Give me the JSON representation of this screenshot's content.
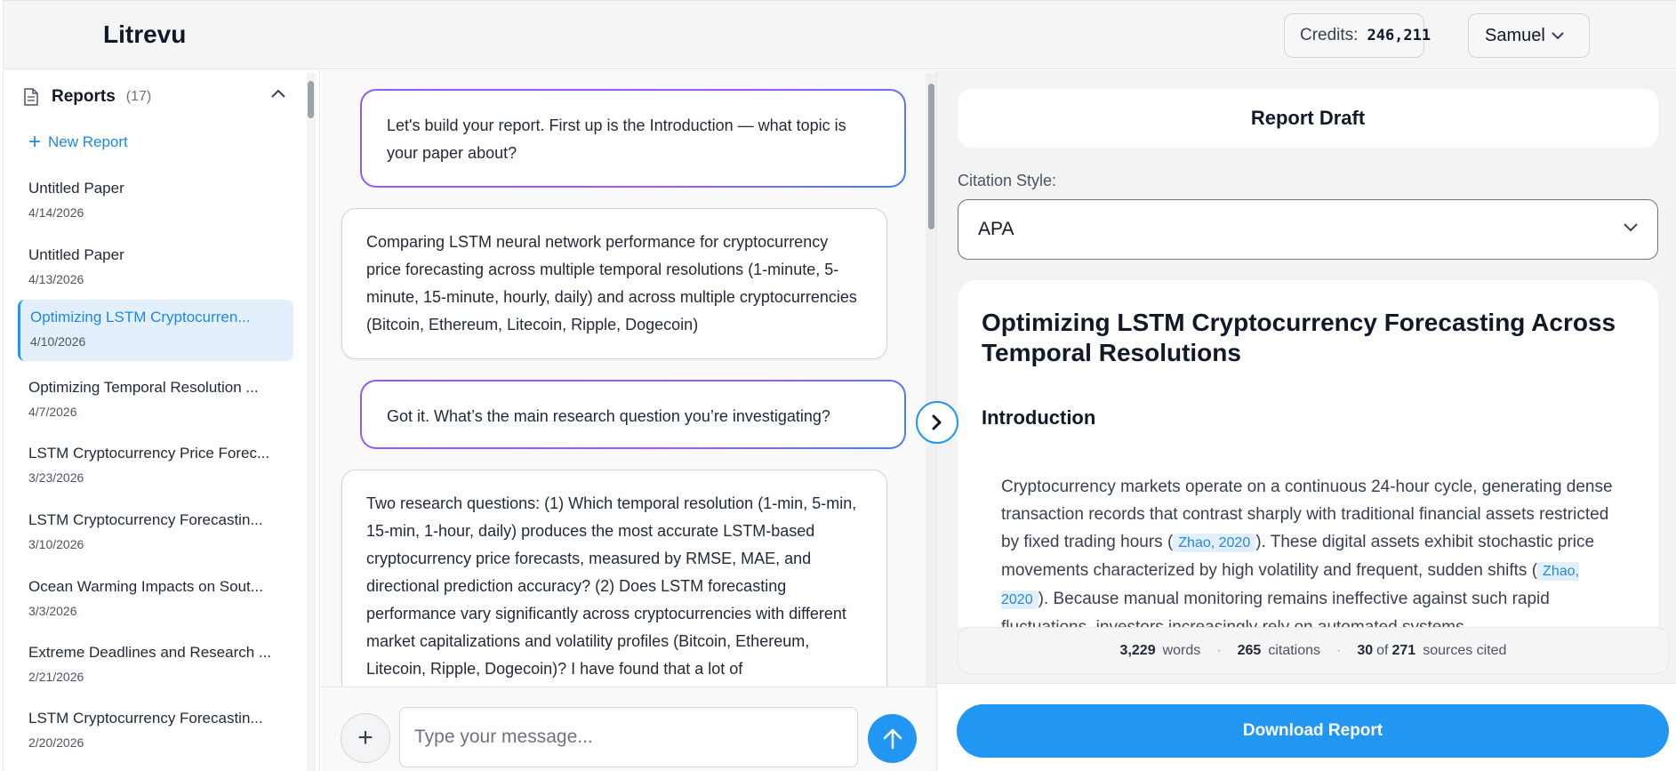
{
  "app": {
    "brand": "Litrevu"
  },
  "header": {
    "credits_label": "Credits:",
    "credits_value": "246,211",
    "user_name": "Samuel"
  },
  "sidebar": {
    "title": "Reports",
    "count": "(17)",
    "new_report_label": "New Report",
    "items": [
      {
        "title": "Untitled Paper",
        "date": "4/14/2026"
      },
      {
        "title": "Untitled Paper",
        "date": "4/13/2026"
      },
      {
        "title": "Optimizing LSTM Cryptocurren...",
        "date": "4/10/2026",
        "active": true
      },
      {
        "title": "Optimizing Temporal Resolution ...",
        "date": "4/7/2026"
      },
      {
        "title": "LSTM Cryptocurrency Price Forec...",
        "date": "3/23/2026"
      },
      {
        "title": "LSTM Cryptocurrency Forecastin...",
        "date": "3/10/2026"
      },
      {
        "title": "Ocean Warming Impacts on Sout...",
        "date": "3/3/2026"
      },
      {
        "title": "Extreme Deadlines and Research ...",
        "date": "2/21/2026"
      },
      {
        "title": "LSTM Cryptocurrency Forecastin...",
        "date": "2/20/2026"
      }
    ]
  },
  "chat": {
    "messages": [
      {
        "role": "assistant",
        "text": "Let's build your report. First up is the Introduction — what topic is your paper about?"
      },
      {
        "role": "user",
        "text": "Comparing LSTM neural network performance for cryptocurrency price forecasting across multiple temporal resolutions (1-minute, 5-minute, 15-minute, hourly, daily) and across multiple cryptocurrencies (Bitcoin, Ethereum, Litecoin, Ripple, Dogecoin)"
      },
      {
        "role": "assistant",
        "text": "Got it. What’s the main research question you’re investigating?"
      },
      {
        "role": "user",
        "text": "Two research questions: (1) Which temporal resolution (1-min, 5-min, 15-min, 1-hour, daily) produces the most accurate LSTM-based cryptocurrency price forecasts, measured by RMSE, MAE, and directional prediction accuracy? (2) Does LSTM forecasting performance vary significantly across cryptocurrencies with different market capitalizations and volatility profiles (Bitcoin, Ethereum, Litecoin, Ripple, Dogecoin)? I have found that a lot of"
      }
    ],
    "input_placeholder": "Type your message...",
    "attach_symbol": "+"
  },
  "draft": {
    "header": "Report Draft",
    "citation_style_label": "Citation Style:",
    "citation_style_value": "APA",
    "title": "Optimizing LSTM Cryptocurrency Forecasting Across Temporal Resolutions",
    "section_heading": "Introduction",
    "body": {
      "p1": "Cryptocurrency markets operate on a continuous 24-hour cycle, generating dense transaction records that contrast sharply with traditional financial assets restricted by fixed trading hours (",
      "cite1": "Zhao, 2020",
      "p2": "). These digital assets exhibit stochastic price movements characterized by high volatility and frequent, sudden shifts (",
      "cite2": "Zhao, 2020",
      "p3": "). Because manual monitoring remains ineffective against such rapid fluctuations, investors increasingly rely on automated systems"
    },
    "stats": {
      "words_value": "3,229",
      "words_label": "words",
      "citations_value": "265",
      "citations_label": "citations",
      "cited_value": "30",
      "of_label": "of",
      "sources_value": "271",
      "sources_label": "sources cited",
      "separator": "·"
    },
    "download_label": "Download Report"
  }
}
